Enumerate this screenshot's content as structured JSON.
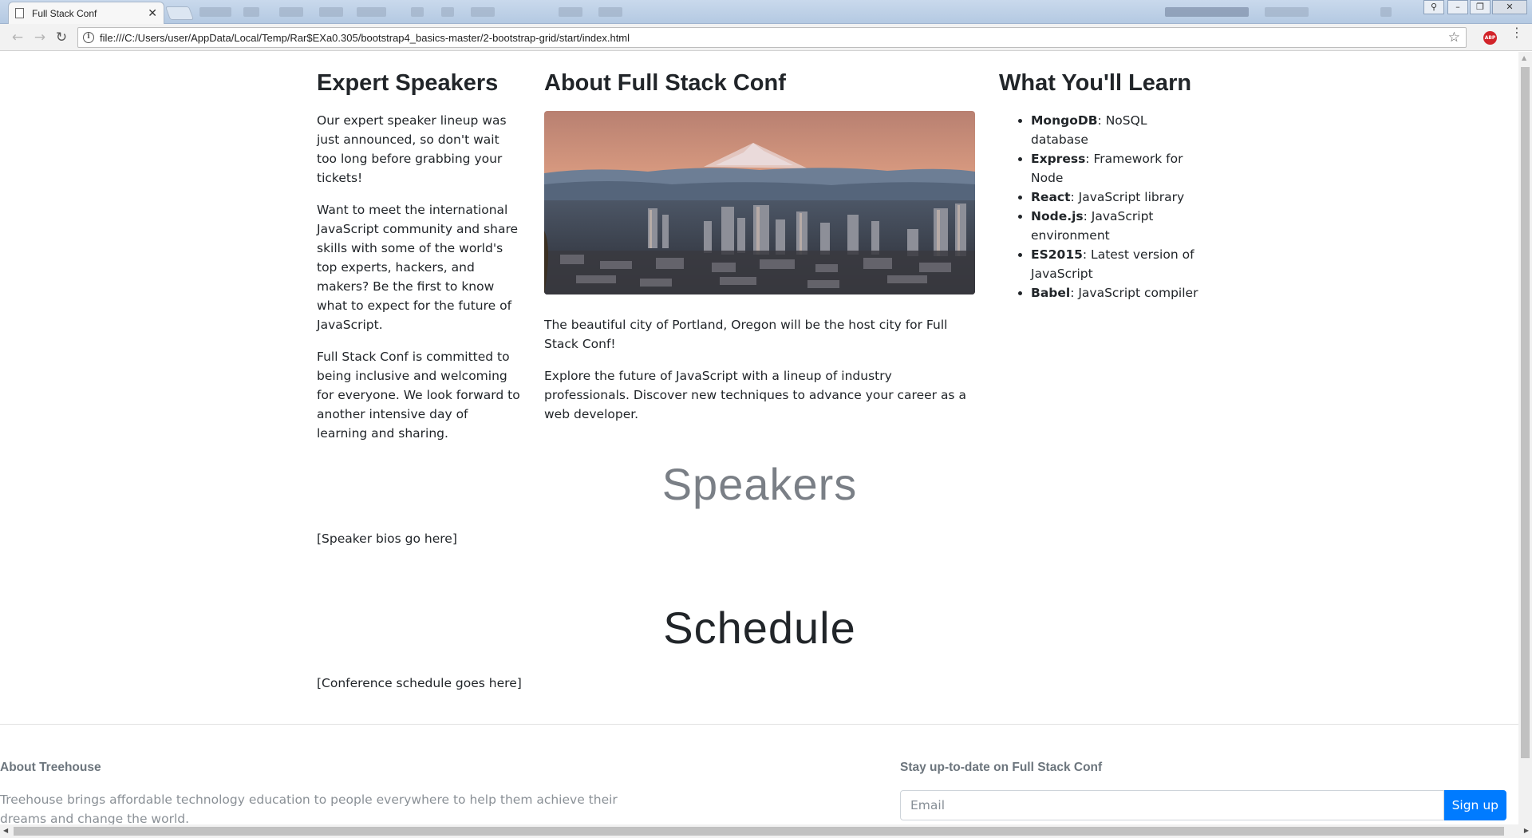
{
  "browser": {
    "tab_title": "Full Stack Conf",
    "tab_close": "✕",
    "url": "file:///C:/Users/user/AppData/Local/Temp/Rar$EXa0.305/bootstrap4_basics-master/2-bootstrap-grid/start/index.html",
    "adblock_label": "ABP",
    "icons": [
      "back-arrow-icon",
      "forward-arrow-icon",
      "reload-icon",
      "info-icon",
      "star-icon",
      "menu-icon"
    ]
  },
  "columns": {
    "left": {
      "heading": "Expert Speakers",
      "paragraphs": [
        "Our expert speaker lineup was just announced, so don't wait too long before grabbing your tickets!",
        "Want to meet the international JavaScript community and share skills with some of the world's top experts, hackers, and makers? Be the first to know what to expect for the future of JavaScript.",
        "Full Stack Conf is committed to being inclusive and welcoming for everyone. We look forward to another intensive day of learning and sharing."
      ]
    },
    "middle": {
      "heading": "About Full Stack Conf",
      "paragraphs": [
        "The beautiful city of Portland, Oregon will be the host city for Full Stack Conf!",
        "Explore the future of JavaScript with a lineup of industry professionals. Discover new techniques to advance your career as a web developer."
      ]
    },
    "right": {
      "heading": "What You'll Learn",
      "items": [
        {
          "term": "MongoDB",
          "desc": ": NoSQL database"
        },
        {
          "term": "Express",
          "desc": ": Framework for Node"
        },
        {
          "term": "React",
          "desc": ": JavaScript library"
        },
        {
          "term": "Node.js",
          "desc": ": JavaScript environment"
        },
        {
          "term": "ES2015",
          "desc": ": Latest version of JavaScript"
        },
        {
          "term": "Babel",
          "desc": ": JavaScript compiler"
        }
      ]
    }
  },
  "speakers": {
    "title": "Speakers",
    "placeholder": "[Speaker bios go here]"
  },
  "schedule": {
    "title": "Schedule",
    "placeholder": "[Conference schedule goes here]"
  },
  "footer": {
    "about_heading": "About Treehouse",
    "about_text": "Treehouse brings affordable technology education to people everywhere to help them achieve their dreams and change the world.",
    "newsletter_heading": "Stay up-to-date on Full Stack Conf",
    "email_placeholder": "Email",
    "signup_label": "Sign up"
  },
  "colors": {
    "primary": "#007bff",
    "muted": "#6c757d",
    "text": "#212529"
  }
}
